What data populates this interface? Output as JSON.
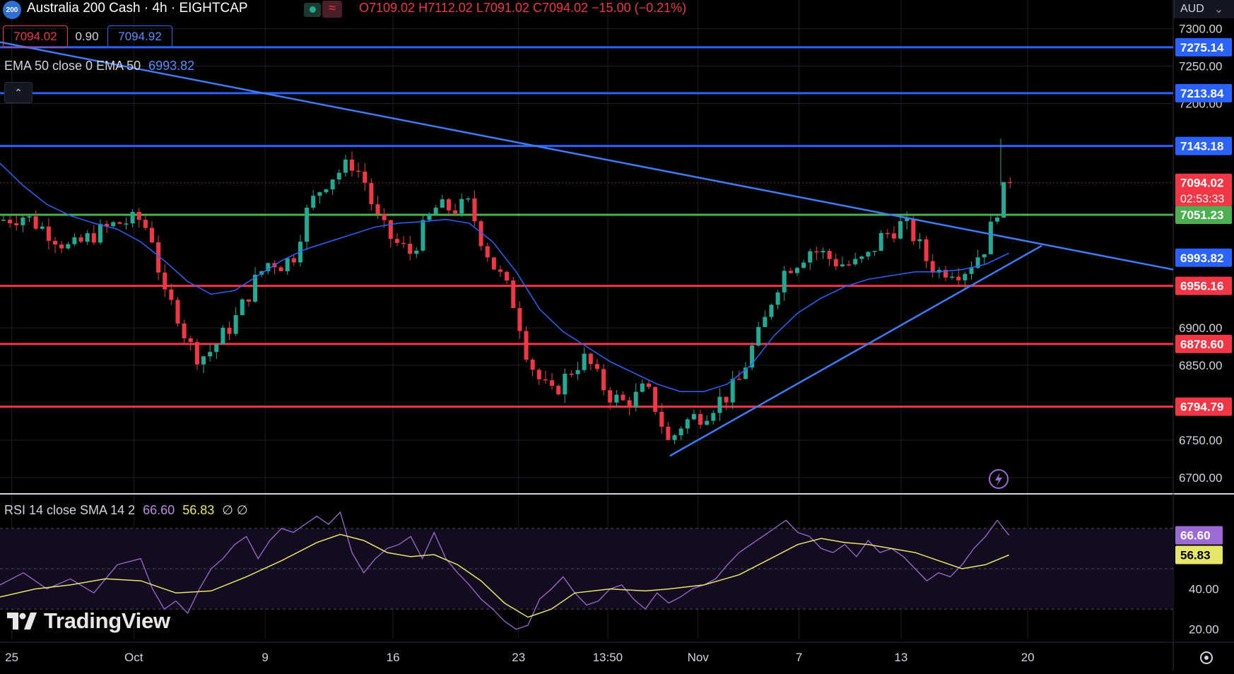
{
  "header": {
    "symbol_badge": "200",
    "title": "Australia 200 Cash · 4h · EIGHTCAP",
    "wave_icon": "≈",
    "ohlc": {
      "open": "O7109.02",
      "high": "H7112.02",
      "low": "L7091.02",
      "close": "C7094.02",
      "change": "−15.00 (−0.21%)"
    },
    "bid": "7094.02",
    "spread": "0.90",
    "ask": "7094.92",
    "currency": "AUD",
    "currency_chevron": "⌄"
  },
  "indicators": {
    "ema_label": "EMA 50 close 0 EMA 50",
    "ema_value": "6993.82",
    "collapse_icon": "⌃",
    "rsi_label": "RSI 14 close SMA 14 2",
    "rsi_value": "66.60",
    "rsi_sma_value": "56.83",
    "rsi_extra": "∅ ∅"
  },
  "branding": {
    "logo_text": "TradingView"
  },
  "colors": {
    "background": "#000000",
    "up": "#22ab94",
    "down": "#f23645",
    "ema": "#2962ff",
    "blue_level": "#2962ff",
    "green_level": "#4caf50",
    "red_level": "#f23645",
    "trendline": "#3d7cf5",
    "rsi": "#9c6ad4",
    "rsi_sma": "#e6e66a"
  },
  "chart_data": {
    "type": "candlestick",
    "title": "Australia 200 Cash · 4h · EIGHTCAP",
    "y_axis": {
      "ticks": [
        "7300.00",
        "7250.00",
        "7200.00",
        "6900.00",
        "6850.00",
        "6750.00",
        "6700.00"
      ],
      "ylim": [
        6682,
        7310
      ]
    },
    "x_axis": {
      "ticks": [
        "25",
        "Oct",
        "9",
        "16",
        "23",
        "13:50",
        "Nov",
        "7",
        "13",
        "20"
      ],
      "xlim": [
        0,
        100
      ]
    },
    "levels": [
      {
        "value": 7275.14,
        "label": "7275.14",
        "color": "blue"
      },
      {
        "value": 7213.84,
        "label": "7213.84",
        "color": "blue"
      },
      {
        "value": 7143.18,
        "label": "7143.18",
        "color": "blue"
      },
      {
        "value": 7051.23,
        "label": "7051.23",
        "color": "green"
      },
      {
        "value": 6956.16,
        "label": "6956.16",
        "color": "red"
      },
      {
        "value": 6878.6,
        "label": "6878.60",
        "color": "red"
      },
      {
        "value": 6794.79,
        "label": "6794.79",
        "color": "red"
      }
    ],
    "price_label": {
      "value": 7094.02,
      "label": "7094.02",
      "countdown": "02:53:33"
    },
    "ema_label": {
      "value": 6993.82,
      "label": "6993.82"
    },
    "trendlines": [
      {
        "name": "descending resistance",
        "points": [
          [
            0,
            7282
          ],
          [
            100,
            6978
          ]
        ]
      },
      {
        "name": "ascending support",
        "points": [
          [
            57.1,
            6729
          ],
          [
            88.8,
            7010
          ]
        ]
      }
    ],
    "close_path": [
      [
        0,
        7044
      ],
      [
        2,
        7050
      ],
      [
        4,
        7030
      ],
      [
        6,
        7005
      ],
      [
        8,
        7025
      ],
      [
        10,
        7040
      ],
      [
        12,
        7045
      ],
      [
        13,
        7020
      ],
      [
        14,
        6940
      ],
      [
        15,
        6925
      ],
      [
        16,
        6880
      ],
      [
        17,
        6860
      ],
      [
        18,
        6870
      ],
      [
        19,
        6890
      ],
      [
        20,
        6910
      ],
      [
        21,
        6940
      ],
      [
        22,
        6970
      ],
      [
        23,
        6990
      ],
      [
        24,
        6985
      ],
      [
        25,
        6995
      ],
      [
        26,
        7050
      ],
      [
        27,
        7080
      ],
      [
        28,
        7100
      ],
      [
        29,
        7110
      ],
      [
        30,
        7120
      ],
      [
        31,
        7100
      ],
      [
        32,
        7050
      ],
      [
        33,
        7025
      ],
      [
        34,
        7010
      ],
      [
        35,
        7000
      ],
      [
        36,
        7030
      ],
      [
        37,
        7060
      ],
      [
        38,
        7060
      ],
      [
        39,
        7060
      ],
      [
        40,
        7065
      ],
      [
        41,
        7020
      ],
      [
        42,
        6985
      ],
      [
        43,
        6960
      ],
      [
        44,
        6925
      ],
      [
        45,
        6860
      ],
      [
        46,
        6830
      ],
      [
        47,
        6810
      ],
      [
        48,
        6830
      ],
      [
        49,
        6850
      ],
      [
        50,
        6860
      ],
      [
        51,
        6830
      ],
      [
        52,
        6810
      ],
      [
        53,
        6800
      ],
      [
        54,
        6805
      ],
      [
        55,
        6820
      ],
      [
        56,
        6790
      ],
      [
        57,
        6745
      ],
      [
        58,
        6770
      ],
      [
        59,
        6780
      ],
      [
        60,
        6785
      ],
      [
        61,
        6800
      ],
      [
        62,
        6810
      ],
      [
        63,
        6830
      ],
      [
        64,
        6870
      ],
      [
        65,
        6900
      ],
      [
        66,
        6950
      ],
      [
        67,
        6980
      ],
      [
        68,
        6990
      ],
      [
        69,
        7005
      ],
      [
        70,
        7000
      ],
      [
        71,
        6990
      ],
      [
        72,
        6985
      ],
      [
        73,
        6985
      ],
      [
        74,
        6995
      ],
      [
        75,
        7020
      ],
      [
        76,
        7030
      ],
      [
        77,
        7040
      ],
      [
        78,
        7020
      ],
      [
        79,
        6990
      ],
      [
        80,
        6975
      ],
      [
        81,
        6980
      ],
      [
        82,
        6975
      ],
      [
        83,
        6990
      ],
      [
        84,
        7010
      ],
      [
        85,
        7060
      ],
      [
        86,
        7100
      ],
      [
        86.5,
        7094
      ]
    ],
    "ema_path": [
      [
        0,
        7120
      ],
      [
        2,
        7090
      ],
      [
        4,
        7065
      ],
      [
        6,
        7050
      ],
      [
        8,
        7040
      ],
      [
        10,
        7032
      ],
      [
        12,
        7015
      ],
      [
        14,
        6990
      ],
      [
        16,
        6962
      ],
      [
        18,
        6945
      ],
      [
        20,
        6950
      ],
      [
        22,
        6970
      ],
      [
        24,
        6990
      ],
      [
        26,
        7005
      ],
      [
        28,
        7015
      ],
      [
        30,
        7025
      ],
      [
        32,
        7035
      ],
      [
        34,
        7040
      ],
      [
        36,
        7042
      ],
      [
        38,
        7045
      ],
      [
        40,
        7040
      ],
      [
        42,
        7015
      ],
      [
        44,
        6975
      ],
      [
        46,
        6925
      ],
      [
        48,
        6895
      ],
      [
        50,
        6875
      ],
      [
        52,
        6855
      ],
      [
        54,
        6840
      ],
      [
        56,
        6825
      ],
      [
        58,
        6815
      ],
      [
        60,
        6815
      ],
      [
        62,
        6825
      ],
      [
        64,
        6850
      ],
      [
        66,
        6890
      ],
      [
        68,
        6920
      ],
      [
        70,
        6940
      ],
      [
        72,
        6955
      ],
      [
        74,
        6965
      ],
      [
        76,
        6970
      ],
      [
        78,
        6975
      ],
      [
        80,
        6975
      ],
      [
        82,
        6978
      ],
      [
        84,
        6985
      ],
      [
        86,
        7000
      ]
    ],
    "rsi": {
      "ylim": [
        15,
        85
      ],
      "ticks": [
        "40.00",
        "20.00"
      ],
      "bands": [
        30,
        50,
        70
      ],
      "rsi_label": {
        "value": 66.6,
        "label": "66.60"
      },
      "sma_label": {
        "value": 56.83,
        "label": "56.83"
      },
      "rsi_path": [
        [
          0,
          42
        ],
        [
          2,
          48
        ],
        [
          4,
          40
        ],
        [
          6,
          45
        ],
        [
          8,
          38
        ],
        [
          10,
          52
        ],
        [
          12,
          55
        ],
        [
          13,
          40
        ],
        [
          14,
          30
        ],
        [
          15,
          34
        ],
        [
          16,
          28
        ],
        [
          17,
          40
        ],
        [
          18,
          50
        ],
        [
          19,
          55
        ],
        [
          20,
          62
        ],
        [
          21,
          66
        ],
        [
          22,
          55
        ],
        [
          23,
          64
        ],
        [
          24,
          70
        ],
        [
          25,
          68
        ],
        [
          26,
          72
        ],
        [
          27,
          76
        ],
        [
          28,
          72
        ],
        [
          29,
          78
        ],
        [
          30,
          58
        ],
        [
          31,
          48
        ],
        [
          32,
          55
        ],
        [
          33,
          60
        ],
        [
          34,
          62
        ],
        [
          35,
          66
        ],
        [
          36,
          55
        ],
        [
          37,
          68
        ],
        [
          38,
          55
        ],
        [
          39,
          48
        ],
        [
          40,
          42
        ],
        [
          41,
          35
        ],
        [
          42,
          30
        ],
        [
          43,
          24
        ],
        [
          44,
          20
        ],
        [
          45,
          22
        ],
        [
          46,
          35
        ],
        [
          47,
          40
        ],
        [
          48,
          46
        ],
        [
          49,
          38
        ],
        [
          50,
          32
        ],
        [
          51,
          34
        ],
        [
          52,
          40
        ],
        [
          53,
          42
        ],
        [
          54,
          35
        ],
        [
          55,
          30
        ],
        [
          56,
          38
        ],
        [
          57,
          33
        ],
        [
          58,
          36
        ],
        [
          59,
          40
        ],
        [
          60,
          42
        ],
        [
          61,
          45
        ],
        [
          62,
          52
        ],
        [
          63,
          58
        ],
        [
          64,
          62
        ],
        [
          65,
          66
        ],
        [
          66,
          70
        ],
        [
          67,
          74
        ],
        [
          68,
          68
        ],
        [
          69,
          66
        ],
        [
          70,
          60
        ],
        [
          71,
          58
        ],
        [
          72,
          62
        ],
        [
          73,
          56
        ],
        [
          74,
          64
        ],
        [
          75,
          58
        ],
        [
          76,
          60
        ],
        [
          77,
          56
        ],
        [
          78,
          50
        ],
        [
          79,
          44
        ],
        [
          80,
          48
        ],
        [
          81,
          46
        ],
        [
          82,
          52
        ],
        [
          83,
          60
        ],
        [
          84,
          66
        ],
        [
          85,
          74
        ],
        [
          86,
          66.6
        ]
      ],
      "sma_path": [
        [
          0,
          36
        ],
        [
          3,
          40
        ],
        [
          6,
          42
        ],
        [
          9,
          45
        ],
        [
          12,
          44
        ],
        [
          15,
          38
        ],
        [
          18,
          39
        ],
        [
          21,
          46
        ],
        [
          24,
          54
        ],
        [
          27,
          63
        ],
        [
          29,
          67
        ],
        [
          31,
          64
        ],
        [
          33,
          58
        ],
        [
          35,
          56
        ],
        [
          37,
          57
        ],
        [
          39,
          52
        ],
        [
          41,
          44
        ],
        [
          43,
          33
        ],
        [
          45,
          26
        ],
        [
          47,
          30
        ],
        [
          49,
          38
        ],
        [
          52,
          40
        ],
        [
          55,
          39
        ],
        [
          57,
          40
        ],
        [
          60,
          42
        ],
        [
          63,
          47
        ],
        [
          66,
          56
        ],
        [
          68,
          62
        ],
        [
          70,
          65
        ],
        [
          72,
          63
        ],
        [
          74,
          62
        ],
        [
          76,
          60
        ],
        [
          78,
          58
        ],
        [
          80,
          54
        ],
        [
          82,
          50
        ],
        [
          84,
          52
        ],
        [
          86,
          56.83
        ]
      ]
    }
  }
}
